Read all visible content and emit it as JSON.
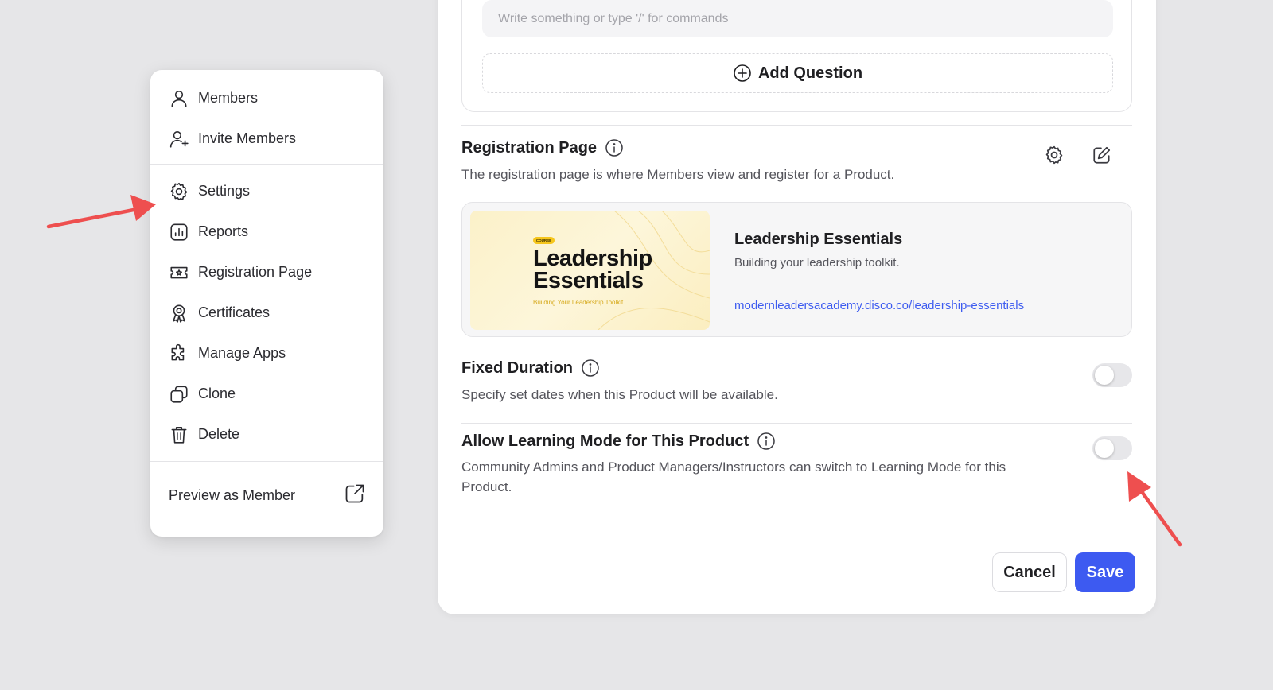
{
  "menu": {
    "items": [
      {
        "label": "Members",
        "icon": "user-icon"
      },
      {
        "label": "Invite Members",
        "icon": "user-plus-icon"
      },
      {
        "label": "Settings",
        "icon": "gear-icon"
      },
      {
        "label": "Reports",
        "icon": "chart-icon"
      },
      {
        "label": "Registration Page",
        "icon": "ticket-icon"
      },
      {
        "label": "Certificates",
        "icon": "award-icon"
      },
      {
        "label": "Manage Apps",
        "icon": "puzzle-icon"
      },
      {
        "label": "Clone",
        "icon": "copy-icon"
      },
      {
        "label": "Delete",
        "icon": "trash-icon"
      }
    ],
    "footer_label": "Preview as Member"
  },
  "questions": {
    "input_placeholder": "Write something or type '/' for commands",
    "add_question_label": "Add Question"
  },
  "registration": {
    "title": "Registration Page",
    "description": "The registration page is where Members view and register for a Product.",
    "card": {
      "badge": "COURSE",
      "thumb_title_line1": "Leadership",
      "thumb_title_line2": "Essentials",
      "thumb_subtitle": "Building Your Leadership Toolkit",
      "name": "Leadership Essentials",
      "tagline": "Building your leadership toolkit.",
      "link": "modernleadersacademy.disco.co/leadership-essentials"
    }
  },
  "fixed_duration": {
    "title": "Fixed Duration",
    "description": "Specify set dates when this Product will be available.",
    "enabled": false
  },
  "learning_mode": {
    "title": "Allow Learning Mode for This Product",
    "description_line1": "Community Admins and Product Managers/Instructors can switch to Learning Mode for this",
    "description_line2": "Product.",
    "enabled": false
  },
  "actions": {
    "cancel_label": "Cancel",
    "save_label": "Save"
  },
  "colors": {
    "accent": "#3d5af1",
    "link": "#3e5cf0",
    "annotation_arrow": "#ee4f4f"
  }
}
